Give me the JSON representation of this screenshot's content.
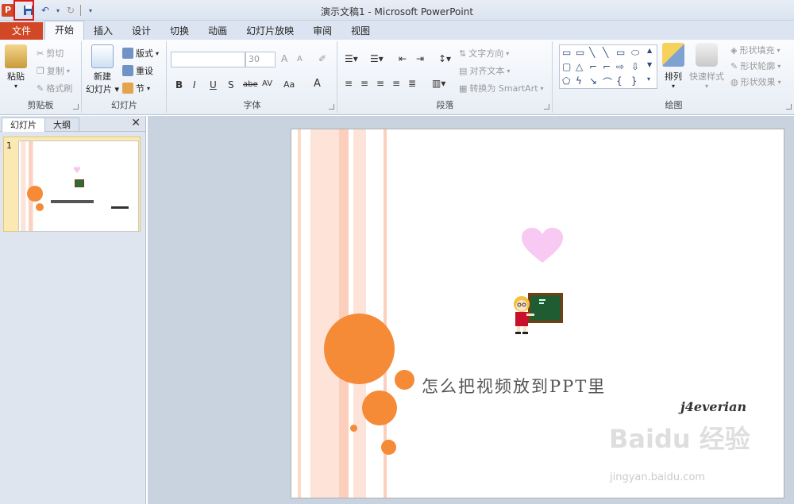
{
  "window": {
    "title": "演示文稿1 - Microsoft PowerPoint"
  },
  "qat": {
    "app_icon": "P",
    "save_icon": "save-icon",
    "undo_icon": "undo-icon",
    "redo_icon": "redo-icon"
  },
  "tabs": [
    "文件",
    "开始",
    "插入",
    "设计",
    "切换",
    "动画",
    "幻灯片放映",
    "审阅",
    "视图"
  ],
  "ribbon": {
    "clipboard": {
      "label": "剪贴板",
      "paste": "粘贴",
      "cut": "剪切",
      "copy": "复制",
      "format_painter": "格式刷"
    },
    "slides": {
      "label": "幻灯片",
      "new_slide_1": "新建",
      "new_slide_2": "幻灯片",
      "layout": "版式",
      "reset": "重设",
      "section": "节"
    },
    "font": {
      "label": "字体",
      "font_name": "",
      "font_size": "30",
      "bold": "B",
      "italic": "I",
      "underline": "U",
      "shadow": "S",
      "strike": "abe",
      "spacing": "AV",
      "case": "Aa",
      "color": "A",
      "grow": "A",
      "shrink": "A"
    },
    "paragraph": {
      "label": "段落",
      "text_direction": "文字方向",
      "align_text": "对齐文本",
      "smartart": "转换为 SmartArt"
    },
    "drawing": {
      "label": "绘图",
      "arrange": "排列",
      "quick_styles": "快速样式",
      "shape_fill": "形状填充",
      "shape_outline": "形状轮廓",
      "shape_effects": "形状效果"
    }
  },
  "left_pane": {
    "tab_slides": "幻灯片",
    "tab_outline": "大纲",
    "close": "✕",
    "slide_number": "1"
  },
  "slide": {
    "title": "怎么把视频放到PPT里",
    "author": "j4everian"
  },
  "watermark": {
    "brand": "Baidu 经验",
    "url": "jingyan.baidu.com"
  }
}
